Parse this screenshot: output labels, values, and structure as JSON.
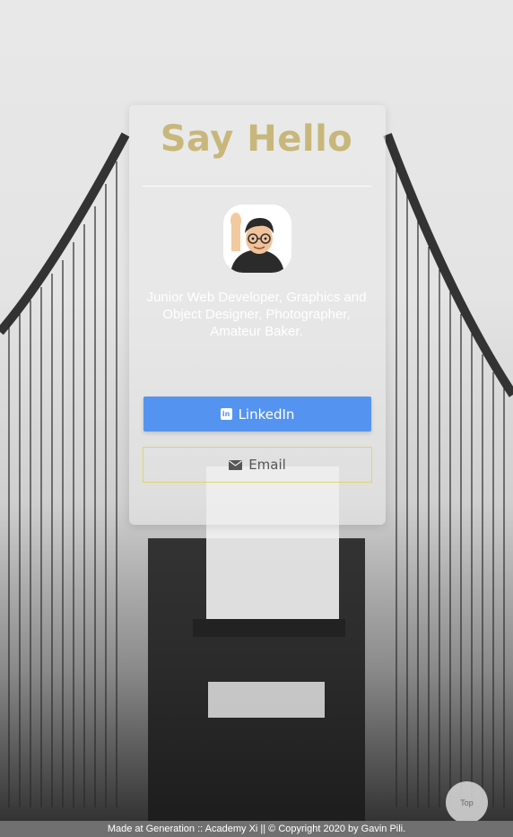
{
  "card": {
    "title": "Say Hello",
    "bio": "Junior Web Developer, Graphics and Object Designer, Photographer, Amateur Baker."
  },
  "buttons": {
    "linkedin_label": "LinkedIn",
    "email_label": "Email",
    "top_label": "Top"
  },
  "footer": {
    "text": "Made at Generation :: Academy Xi || © Copyright 2020 by Gavin Pili."
  },
  "icons": {
    "linkedin": "linkedin-icon",
    "email": "envelope-icon",
    "avatar": "memoji-avatar"
  },
  "colors": {
    "title": "#c8b77a",
    "linkedin_button": "#5593f0",
    "email_border": "#e0d56a",
    "footer_bg": "#707070"
  }
}
